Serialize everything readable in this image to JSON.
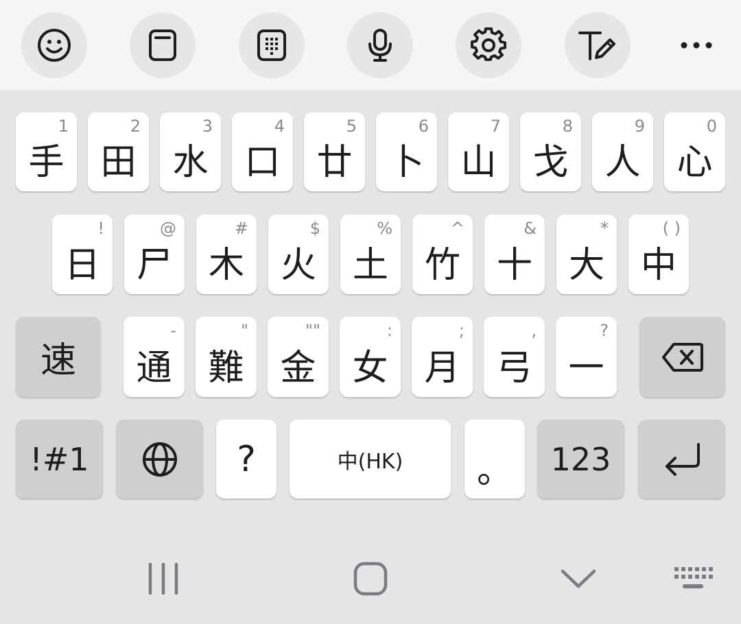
{
  "toolbar": {
    "buttons": [
      {
        "icon": "emoji-icon"
      },
      {
        "icon": "clipboard-icon"
      },
      {
        "icon": "keypad-icon"
      },
      {
        "icon": "microphone-icon"
      },
      {
        "icon": "settings-icon"
      },
      {
        "icon": "handwriting-icon"
      },
      {
        "icon": "more-icon"
      }
    ]
  },
  "rows": {
    "r1": [
      {
        "main": "手",
        "hint": "1"
      },
      {
        "main": "田",
        "hint": "2"
      },
      {
        "main": "水",
        "hint": "3"
      },
      {
        "main": "口",
        "hint": "4"
      },
      {
        "main": "廿",
        "hint": "5"
      },
      {
        "main": "卜",
        "hint": "6"
      },
      {
        "main": "山",
        "hint": "7"
      },
      {
        "main": "戈",
        "hint": "8"
      },
      {
        "main": "人",
        "hint": "9"
      },
      {
        "main": "心",
        "hint": "0"
      }
    ],
    "r2": [
      {
        "main": "日",
        "hint": "!"
      },
      {
        "main": "尸",
        "hint": "@"
      },
      {
        "main": "木",
        "hint": "#"
      },
      {
        "main": "火",
        "hint": "$"
      },
      {
        "main": "土",
        "hint": "%"
      },
      {
        "main": "竹",
        "hint": "^"
      },
      {
        "main": "十",
        "hint": "&"
      },
      {
        "main": "大",
        "hint": "*"
      },
      {
        "main": "中",
        "hint": "( )"
      }
    ],
    "r3": [
      {
        "main": "通",
        "hint": "-"
      },
      {
        "main": "難",
        "hint": "\""
      },
      {
        "main": "金",
        "hint": "\"\""
      },
      {
        "main": "女",
        "hint": ":"
      },
      {
        "main": "月",
        "hint": ";"
      },
      {
        "main": "弓",
        "hint": ","
      },
      {
        "main": "一",
        "hint": "?"
      }
    ]
  },
  "keys": {
    "quick_label": "速",
    "symbols_label": "!#1",
    "question_label": "?",
    "space_label": "中(HK)",
    "period_label": "。",
    "numbers_label": "123"
  },
  "colors": {
    "keyboard_bg": "#e5e5e7",
    "key_bg": "#ffffff",
    "func_key_bg": "#cfcfd1",
    "text": "#1d1d1f",
    "hint": "#8a8a8e"
  }
}
